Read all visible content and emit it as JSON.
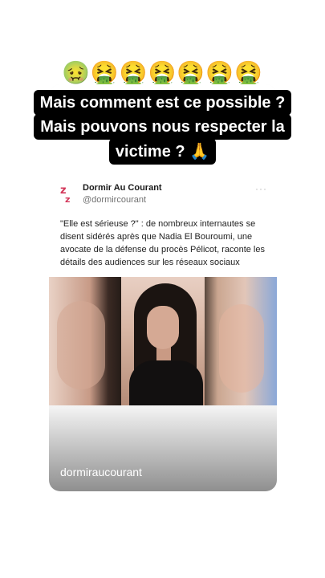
{
  "emoji_row": "🤢🤮🤮🤮🤮🤮🤮",
  "caption": {
    "line1": "Mais comment est ce possible ?",
    "line2": "Mais pouvons nous respecter la",
    "line3": "victime ?",
    "line3_emoji": "🙏"
  },
  "tweet": {
    "account_name": "Dormir Au Courant",
    "handle": "@dormircourant",
    "more_icon": "···",
    "text": "\"Elle est sérieuse ?\" : de nombreux internautes se disent sidérés après que Nadia El Bouroumi, une avocate de la défense du procès Pélicot, raconte les détails des audiences sur les réseaux sociaux"
  },
  "watermark": "dormiraucourant",
  "colors": {
    "caption_bg": "#000000",
    "caption_text": "#ffffff",
    "logo": "#d3375a"
  }
}
